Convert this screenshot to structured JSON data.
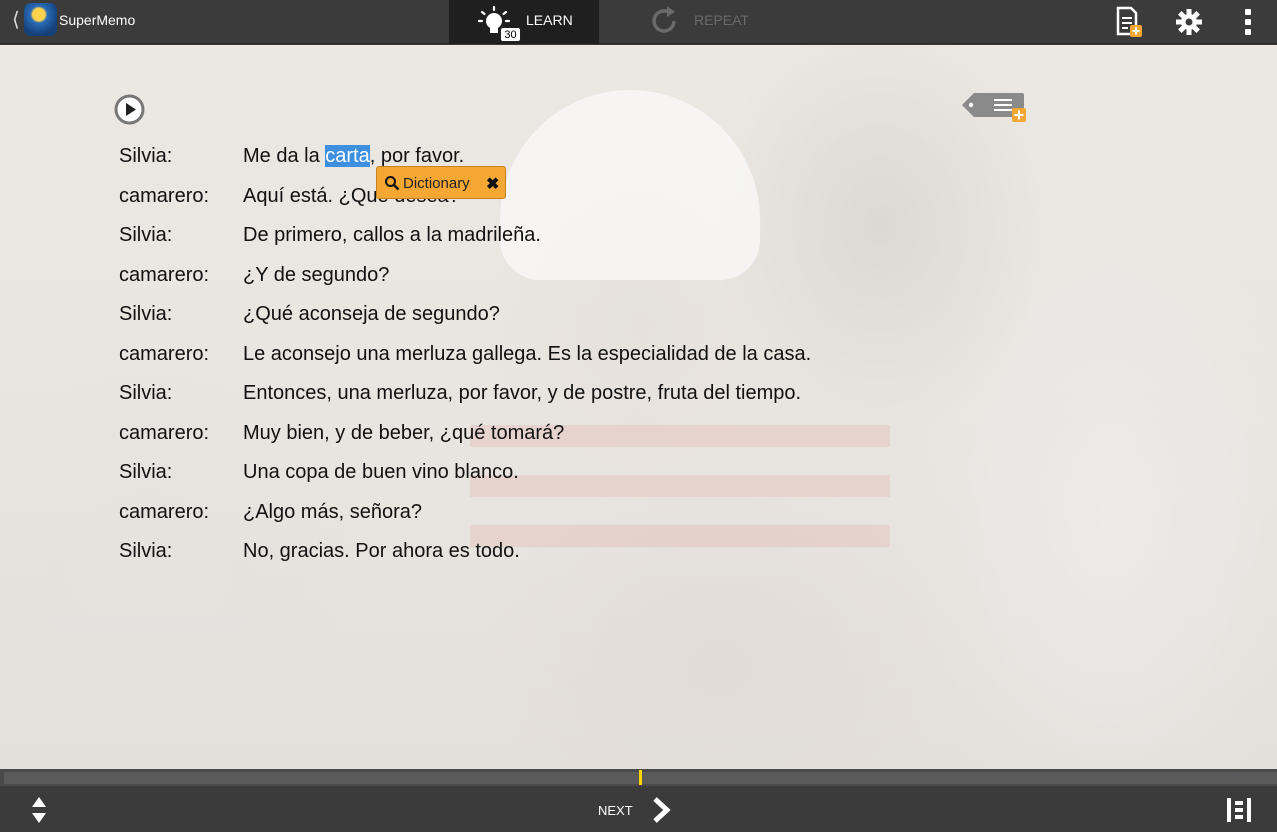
{
  "app": {
    "name": "SuperMemo"
  },
  "topbar": {
    "learn_label": "LEARN",
    "learn_count": "30",
    "repeat_label": "REPEAT",
    "icons": [
      "back-icon",
      "supermemo-logo",
      "bulb-icon",
      "repeat-icon",
      "add-document-icon",
      "gear-icon",
      "more-vertical-icon"
    ]
  },
  "dialog": {
    "lines": [
      {
        "speaker": "Silvia:",
        "text": "Me da la carta, por favor.",
        "pre": "Me da la ",
        "highlight": "carta",
        "post": ", por favor."
      },
      {
        "speaker": "camarero:",
        "text": "Aquí está. ¿Qué desea?"
      },
      {
        "speaker": "Silvia:",
        "text": "De primero, callos a la madrileña."
      },
      {
        "speaker": "camarero:",
        "text": "¿Y de segundo?"
      },
      {
        "speaker": "Silvia:",
        "text": "¿Qué aconseja de segundo?"
      },
      {
        "speaker": "camarero:",
        "text": "Le aconsejo una merluza gallega. Es la especialidad de la casa."
      },
      {
        "speaker": "Silvia:",
        "text": "Entonces, una merluza, por favor, y de postre, fruta del tiempo."
      },
      {
        "speaker": "camarero:",
        "text": "Muy bien, y de beber, ¿qué tomará?"
      },
      {
        "speaker": "Silvia:",
        "text": "Una copa de buen vino blanco."
      },
      {
        "speaker": "camarero:",
        "text": "¿Algo más, señora?"
      },
      {
        "speaker": "Silvia:",
        "text": "No, gracias. Por ahora es todo."
      }
    ]
  },
  "popup": {
    "label": "Dictionary"
  },
  "progress": {
    "fraction": 0.5
  },
  "bottombar": {
    "next_label": "NEXT"
  },
  "colors": {
    "accent": "#f5a733",
    "highlight": "#3d8fe0",
    "progress_marker": "#ffd500"
  }
}
